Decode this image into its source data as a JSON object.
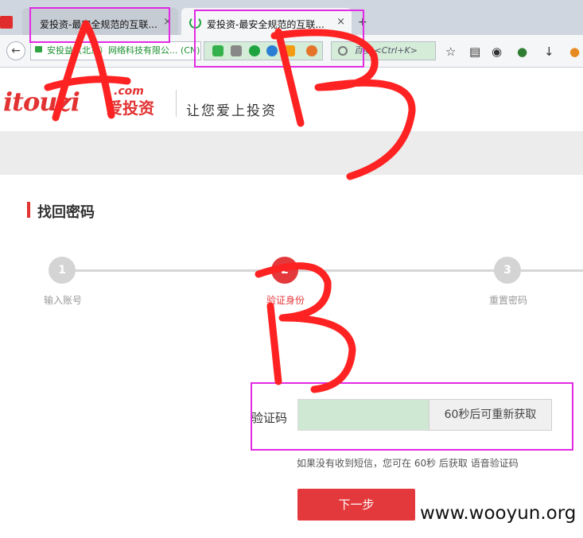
{
  "browser": {
    "tabs": [
      {
        "label": "爱投资-最安全规范的互联...",
        "close": "×"
      },
      {
        "label": "爱投资-最安全规范的互联...",
        "close": "×"
      }
    ],
    "new_tab": "+",
    "url": "安投益（北京）网络科技有限公... (CN)",
    "search_placeholder": "百度 <Ctrl+K>"
  },
  "header": {
    "brand": "itouzi",
    "brand_com": ".com",
    "brand_cn": "爱投资",
    "slogan": "让您爱上投资"
  },
  "page": {
    "title": "找回密码",
    "steps": [
      {
        "number": "1",
        "label": "输入账号",
        "state": "done"
      },
      {
        "number": "2",
        "label": "验证身份",
        "state": "active"
      },
      {
        "number": "3",
        "label": "重置密码",
        "state": "pending"
      }
    ],
    "code_label": "验证码",
    "code_value": "",
    "resend_button": "60秒后可重新获取",
    "hint": "如果没有收到短信，您可在 60秒 后获取 语音验证码",
    "next_button": "下一步"
  },
  "annotations": {
    "letters": [
      "A",
      "B",
      "B"
    ]
  },
  "watermark": "www.wooyun.org",
  "colors": {
    "accent": "#e4393c",
    "annotation_box": "#e12be4",
    "scribble": "#ff2222"
  }
}
